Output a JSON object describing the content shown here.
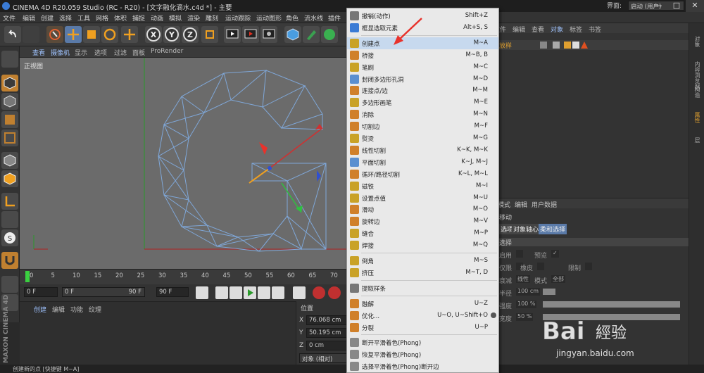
{
  "window": {
    "title": "CINEMA 4D R20.059 Studio (RC - R20) - [文字融化滴水.c4d *] - 主要",
    "layout_label": "界面:",
    "layout_value": "启动 (用户)",
    "min": "—",
    "max": "□",
    "close": "✕"
  },
  "menubar": [
    "文件",
    "编辑",
    "创建",
    "选择",
    "工具",
    "网格",
    "体积",
    "捕捉",
    "动画",
    "模拟",
    "渲染",
    "雕刻",
    "运动跟踪",
    "运动图形",
    "角色",
    "流水线",
    "插件"
  ],
  "viewport": {
    "menu": [
      "查看",
      "摄像机",
      "显示",
      "选项",
      "过滤",
      "面板",
      "ProRender"
    ],
    "label": "正视图"
  },
  "timeline": {
    "ticks": [
      "0",
      "5",
      "10",
      "15",
      "20",
      "25",
      "30",
      "35",
      "40",
      "45",
      "50",
      "55",
      "60",
      "65",
      "70"
    ],
    "start": "0 F",
    "slider_start": "0 F",
    "slider_end": "90 F",
    "end": "90 F"
  },
  "material": {
    "tabs": [
      "创建",
      "编辑",
      "功能",
      "纹理"
    ]
  },
  "coords": {
    "header": "位置",
    "x": "76.068 cm",
    "y": "50.195 cm",
    "z": "0 cm",
    "mode": "对象 (相对)",
    "axis_x": "X",
    "axis_y": "Y",
    "axis_z": "Z"
  },
  "objects": {
    "tabs": [
      "文件",
      "编辑",
      "查看",
      "对象",
      "标签",
      "书签"
    ],
    "item": "放样"
  },
  "attributes": {
    "tabs": [
      "模式",
      "编辑",
      "用户数据"
    ],
    "title": "移动",
    "subtabs": [
      "选项",
      "对象轴心",
      "柔和选择"
    ],
    "section": "选择",
    "rows": [
      {
        "label": "启用",
        "value": ""
      },
      {
        "label": "预览",
        "value": "✓"
      },
      {
        "label": "仅限",
        "value": ""
      },
      {
        "label": "橡皮",
        "value": ""
      },
      {
        "label": "限制",
        "value": ""
      },
      {
        "label": "衰减",
        "value": "线性"
      },
      {
        "label": "模式",
        "value": "全部"
      },
      {
        "label": "半径",
        "value": "100 cm"
      },
      {
        "label": "强度",
        "value": "100 %"
      },
      {
        "label": "宽度",
        "value": "50 %"
      }
    ]
  },
  "right_strip": [
    "对象",
    "内容浏览器",
    "构造",
    "属性",
    "层"
  ],
  "status": "创建新的点 [快捷键 M~A]",
  "maxon": "MAXON CINEMA 4D",
  "context_menu": [
    {
      "label": "撤销(动作)",
      "shortcut": "Shift+Z",
      "color": "#777"
    },
    {
      "label": "框显选取元素",
      "shortcut": "Alt+S, S",
      "color": "#3a7bd5"
    },
    {
      "sep": true
    },
    {
      "label": "创建点",
      "shortcut": "M~A",
      "color": "#c9a227",
      "highlight": true
    },
    {
      "label": "桥接",
      "shortcut": "M~B, B",
      "color": "#d0802a"
    },
    {
      "label": "笔刷",
      "shortcut": "M~C",
      "color": "#c9a227"
    },
    {
      "label": "封闭多边形孔洞",
      "shortcut": "M~D",
      "color": "#5a8fd0"
    },
    {
      "label": "连接点/边",
      "shortcut": "M~M",
      "color": "#d0802a"
    },
    {
      "label": "多边形画笔",
      "shortcut": "M~E",
      "color": "#c9a227"
    },
    {
      "label": "消除",
      "shortcut": "M~N",
      "color": "#d0802a"
    },
    {
      "label": "切割边",
      "shortcut": "M~F",
      "color": "#d0802a"
    },
    {
      "label": "熨烫",
      "shortcut": "M~G",
      "color": "#c9a227"
    },
    {
      "label": "线性切割",
      "shortcut": "K~K, M~K",
      "color": "#d0802a"
    },
    {
      "label": "平面切割",
      "shortcut": "K~J, M~J",
      "color": "#5a8fd0"
    },
    {
      "label": "循环/路径切割",
      "shortcut": "K~L, M~L",
      "color": "#d0802a"
    },
    {
      "label": "磁铁",
      "shortcut": "M~I",
      "color": "#c9a227"
    },
    {
      "label": "设置点值",
      "shortcut": "M~U",
      "color": "#c9a227"
    },
    {
      "label": "滑动",
      "shortcut": "M~O",
      "color": "#d0802a"
    },
    {
      "label": "旋转边",
      "shortcut": "M~V",
      "color": "#d0802a"
    },
    {
      "label": "缝合",
      "shortcut": "M~P",
      "color": "#c9a227"
    },
    {
      "label": "焊接",
      "shortcut": "M~Q",
      "color": "#c9a227"
    },
    {
      "sep": true
    },
    {
      "label": "倒角",
      "shortcut": "M~S",
      "color": "#c9a227"
    },
    {
      "label": "挤压",
      "shortcut": "M~T, D",
      "color": "#c9a227"
    },
    {
      "sep": true
    },
    {
      "label": "提取样条",
      "shortcut": "",
      "color": "#777"
    },
    {
      "sep": true
    },
    {
      "label": "融解",
      "shortcut": "U~Z",
      "color": "#d0802a"
    },
    {
      "label": "优化...",
      "shortcut": "U~O, U~Shift+O",
      "color": "#d0802a",
      "gear": true
    },
    {
      "label": "分裂",
      "shortcut": "U~P",
      "color": "#d0802a"
    },
    {
      "sep": true
    },
    {
      "label": "断开平滑着色(Phong)",
      "shortcut": "",
      "color": "#888"
    },
    {
      "label": "恢复平滑着色(Phong)",
      "shortcut": "",
      "color": "#888"
    },
    {
      "label": "选择平滑着色(Phong)断开边",
      "shortcut": "",
      "color": "#888"
    }
  ],
  "colors": {
    "accent": "#c7d9ee",
    "annotation": "#e8322b"
  }
}
